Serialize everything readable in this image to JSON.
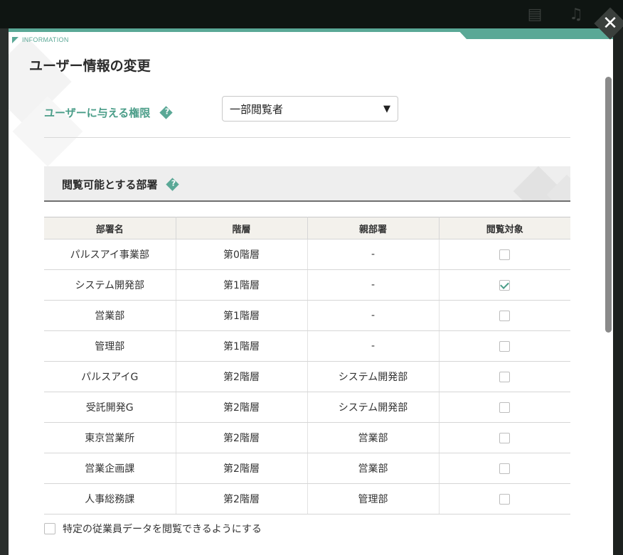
{
  "background": {
    "icons": [
      "cash-register-icon",
      "bell-icon"
    ]
  },
  "modal": {
    "info_tag": "INFORMATION",
    "title": "ユーザー情報の変更",
    "close_glyph": "✕"
  },
  "permission": {
    "label": "ユーザーに与える権限",
    "help_glyph": "?",
    "selected_value": "一部閲覧者",
    "arrow_glyph": "▼"
  },
  "section": {
    "title": "閲覧可能とする部署",
    "help_glyph": "?"
  },
  "table": {
    "headers": [
      "部署名",
      "階層",
      "親部署",
      "閲覧対象"
    ],
    "rows": [
      {
        "name": "パルスアイ事業部",
        "level": "第0階層",
        "parent": "-",
        "checked": false
      },
      {
        "name": "システム開発部",
        "level": "第1階層",
        "parent": "-",
        "checked": true
      },
      {
        "name": "営業部",
        "level": "第1階層",
        "parent": "-",
        "checked": false
      },
      {
        "name": "管理部",
        "level": "第1階層",
        "parent": "-",
        "checked": false
      },
      {
        "name": "パルスアイG",
        "level": "第2階層",
        "parent": "システム開発部",
        "checked": false
      },
      {
        "name": "受託開発G",
        "level": "第2階層",
        "parent": "システム開発部",
        "checked": false
      },
      {
        "name": "東京営業所",
        "level": "第2階層",
        "parent": "営業部",
        "checked": false
      },
      {
        "name": "営業企画課",
        "level": "第2階層",
        "parent": "営業部",
        "checked": false
      },
      {
        "name": "人事総務課",
        "level": "第2階層",
        "parent": "管理部",
        "checked": false
      }
    ]
  },
  "footer": {
    "checkbox_label": "特定の従業員データを閲覧できるようにする",
    "checked": false
  },
  "colors": {
    "accent": "#5aa896",
    "accent_text": "#4a9d88"
  }
}
